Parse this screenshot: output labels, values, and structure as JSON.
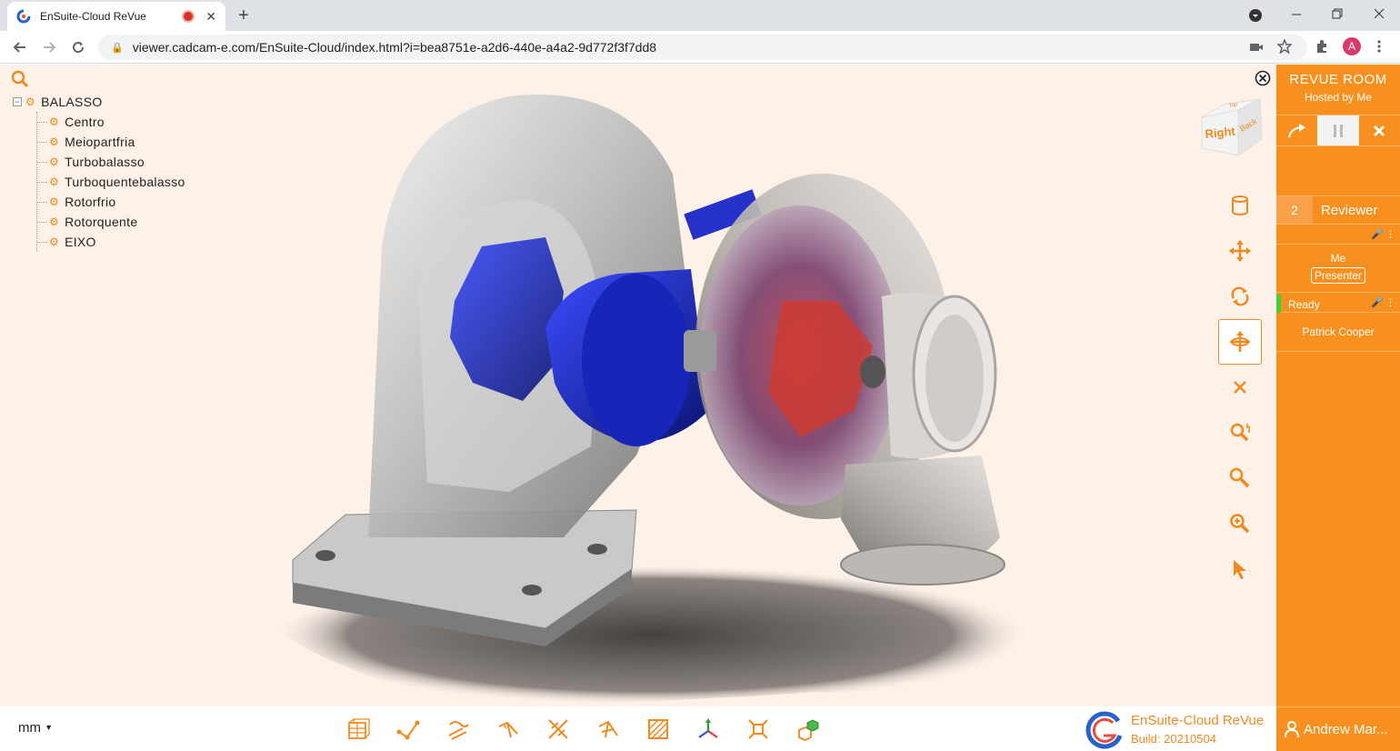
{
  "browser": {
    "tab_title": "EnSuite-Cloud ReVue",
    "tab_close": "✕",
    "new_tab": "+",
    "url": "viewer.cadcam-e.com/EnSuite-Cloud/index.html?i=bea8751e-a2d6-440e-a4a2-9d772f3f7dd8",
    "profile_initial": "A"
  },
  "tree": {
    "root": "BALASSO",
    "children": [
      "Centro",
      "Meiopartfria",
      "Turbobalasso",
      "Turboquentebalasso",
      "Rotorfrio",
      "Rotorquente",
      "EIXO"
    ]
  },
  "navcube": {
    "front": "Right",
    "side": "Back",
    "top": "Top"
  },
  "bottom": {
    "units": "mm",
    "brand_name": "EnSuite-Cloud ReVue",
    "build": "Build: 20210504"
  },
  "panel": {
    "title": "REVUE ROOM",
    "hosted": "Hosted by Me",
    "reviewer_count": "2",
    "reviewer_label": "Reviewer",
    "me": "Me",
    "presenter": "Presenter",
    "ready": "Ready",
    "member2": "Patrick Cooper",
    "user": "Andrew Mar..."
  },
  "colors": {
    "accent": "#f7901e",
    "viewer_bg": "#fdf1e8"
  }
}
